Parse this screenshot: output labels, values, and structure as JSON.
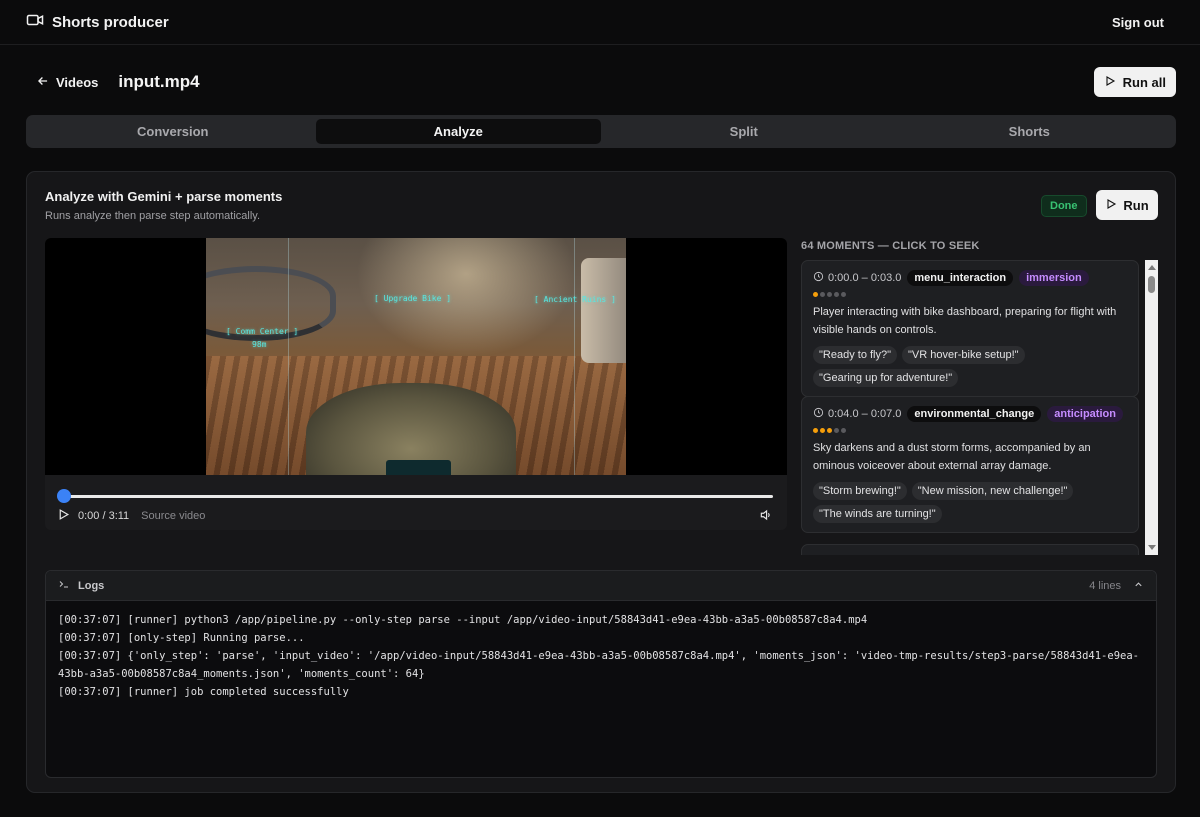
{
  "app": {
    "title": "Shorts producer",
    "sign_out": "Sign out"
  },
  "header": {
    "back_label": "Videos",
    "filename": "input.mp4",
    "run_all": "Run all"
  },
  "tabs": [
    {
      "label": "Conversion",
      "active": false
    },
    {
      "label": "Analyze",
      "active": true
    },
    {
      "label": "Split",
      "active": false
    },
    {
      "label": "Shorts",
      "active": false
    }
  ],
  "panel": {
    "title": "Analyze with Gemini + parse moments",
    "subtitle": "Runs analyze then parse step automatically.",
    "status": "Done",
    "run_label": "Run"
  },
  "player": {
    "time": "0:00 / 3:11",
    "source": "Source video",
    "progress": 0,
    "hud": {
      "upgrade": "[ Upgrade Bike ]",
      "ruins": "[ Ancient Ruins ]",
      "comm": "[ Comm Center ]",
      "dist": "98m"
    }
  },
  "moments": {
    "header": "64 MOMENTS — CLICK TO SEEK",
    "items": [
      {
        "range": "0:00.0 – 0:03.0",
        "tag": "menu_interaction",
        "emotion": "immersion",
        "intensity": 1,
        "intensity_max": 5,
        "description": "Player interacting with bike dashboard, preparing for flight with visible hands on controls.",
        "quotes": [
          "\"Ready to fly?\"",
          "\"VR hover-bike setup!\"",
          "\"Gearing up for adventure!\""
        ]
      },
      {
        "range": "0:04.0 – 0:07.0",
        "tag": "environmental_change",
        "emotion": "anticipation",
        "intensity": 3,
        "intensity_max": 5,
        "description": "Sky darkens and a dust storm forms, accompanied by an ominous voiceover about external array damage.",
        "quotes": [
          "\"Storm brewing!\"",
          "\"New mission, new challenge!\"",
          "\"The winds are turning!\""
        ]
      }
    ]
  },
  "logs": {
    "title": "Logs",
    "count": "4 lines",
    "lines": [
      "[00:37:07] [runner] python3 /app/pipeline.py --only-step parse --input /app/video-input/58843d41-e9ea-43bb-a3a5-00b08587c8a4.mp4",
      "[00:37:07] [only-step] Running parse...",
      "[00:37:07] {'only_step': 'parse', 'input_video': '/app/video-input/58843d41-e9ea-43bb-a3a5-00b08587c8a4.mp4', 'moments_json': 'video-tmp-results/step3-parse/58843d41-e9ea-43bb-a3a5-00b08587c8a4_moments.json', 'moments_count': 64}",
      "[00:37:07] [runner] job completed successfully"
    ]
  },
  "colors": {
    "accent": "#3b82f6",
    "done": "#38c172",
    "emotion": "#c58cff",
    "intensity": "#f59e0b"
  }
}
